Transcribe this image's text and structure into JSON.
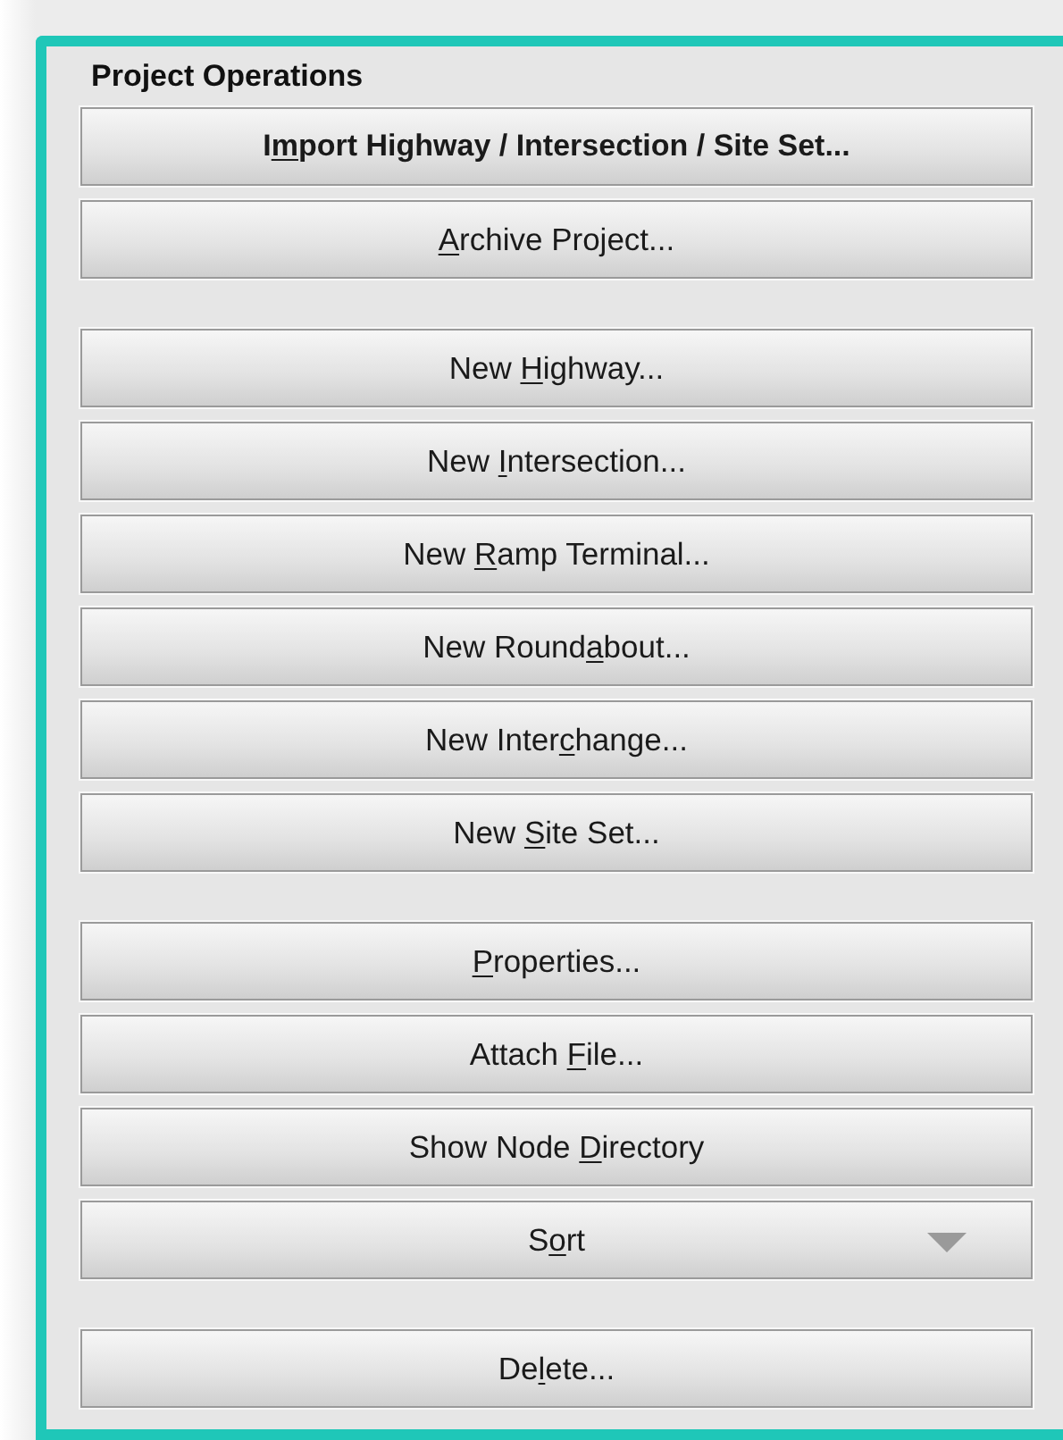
{
  "panel": {
    "title": "Project Operations"
  },
  "groups": [
    {
      "buttons": [
        {
          "kind": "bold",
          "before": "I",
          "key": "m",
          "after": "port Highway / Intersection / Site Set..."
        },
        {
          "kind": "plain",
          "key": "A",
          "after": "rchive Project..."
        }
      ]
    },
    {
      "buttons": [
        {
          "kind": "plain",
          "before": "New ",
          "key": "H",
          "after": "ighway..."
        },
        {
          "kind": "plain",
          "before": "New ",
          "key": "I",
          "after": "ntersection..."
        },
        {
          "kind": "plain",
          "before": "New ",
          "key": "R",
          "after": "amp Terminal..."
        },
        {
          "kind": "plain",
          "before": "New Round",
          "key": "a",
          "after": "bout..."
        },
        {
          "kind": "plain",
          "before": "New Inter",
          "key": "c",
          "after": "hange..."
        },
        {
          "kind": "plain",
          "before": "New ",
          "key": "S",
          "after": "ite Set..."
        }
      ]
    },
    {
      "buttons": [
        {
          "kind": "plain",
          "key": "P",
          "after": "roperties..."
        },
        {
          "kind": "plain",
          "before": "Attach ",
          "key": "F",
          "after": "ile..."
        },
        {
          "kind": "plain",
          "before": "Show Node ",
          "key": "D",
          "after": "irectory"
        },
        {
          "kind": "dropdown",
          "before": "S",
          "key": "o",
          "after": "rt"
        }
      ]
    },
    {
      "buttons": [
        {
          "kind": "plain",
          "before": "De",
          "key": "l",
          "after": "ete..."
        }
      ]
    }
  ]
}
